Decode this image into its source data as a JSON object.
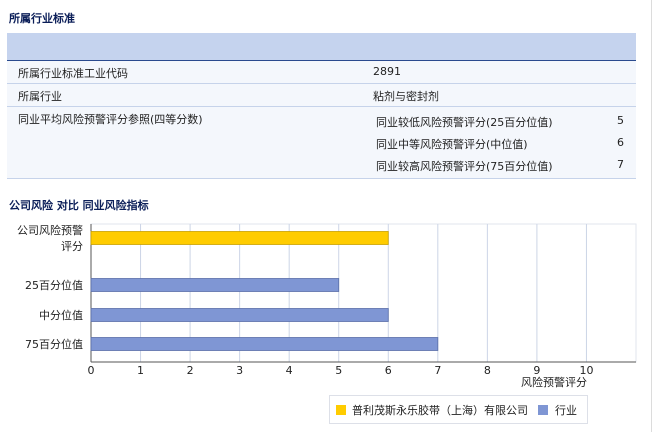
{
  "section1": {
    "title": "所属行业标准",
    "rows": {
      "code_label": "所属行业标准工业代码",
      "code_value": "2891",
      "industry_label": "所属行业",
      "industry_value": "粘剂与密封剂",
      "avg_label": "同业平均风险预警评分参照(四等分数)",
      "sub": [
        {
          "label": "同业较低风险预警评分(25百分位值)",
          "value": "5"
        },
        {
          "label": "同业中等风险预警评分(中位值)",
          "value": "6"
        },
        {
          "label": "同业较高风险预警评分(75百分位值)",
          "value": "7"
        }
      ]
    }
  },
  "section2": {
    "title": "公司风险 对比 同业风险指标"
  },
  "colors": {
    "company": "#ffcc00",
    "industry": "#7f96d4",
    "band": "#c5d3ee",
    "title": "#0b1e58"
  },
  "chart_data": {
    "type": "bar",
    "orientation": "horizontal",
    "categories": [
      "公司风险预警评分",
      "25百分位值",
      "中分位值",
      "75百分位值"
    ],
    "values": [
      6,
      5,
      6,
      7
    ],
    "series_of_bar": [
      "company",
      "industry",
      "industry",
      "industry"
    ],
    "xlabel": "风险预警评分",
    "xlim": [
      0,
      11
    ],
    "xticks": [
      0,
      1,
      2,
      3,
      4,
      5,
      6,
      7,
      8,
      9,
      10
    ],
    "grid": true,
    "legend": {
      "position": "bottom-right",
      "entries": [
        {
          "label": "普利茂斯永乐胶带（上海）有限公司",
          "color": "#ffcc00"
        },
        {
          "label": "行业",
          "color": "#7f96d4"
        }
      ]
    }
  }
}
